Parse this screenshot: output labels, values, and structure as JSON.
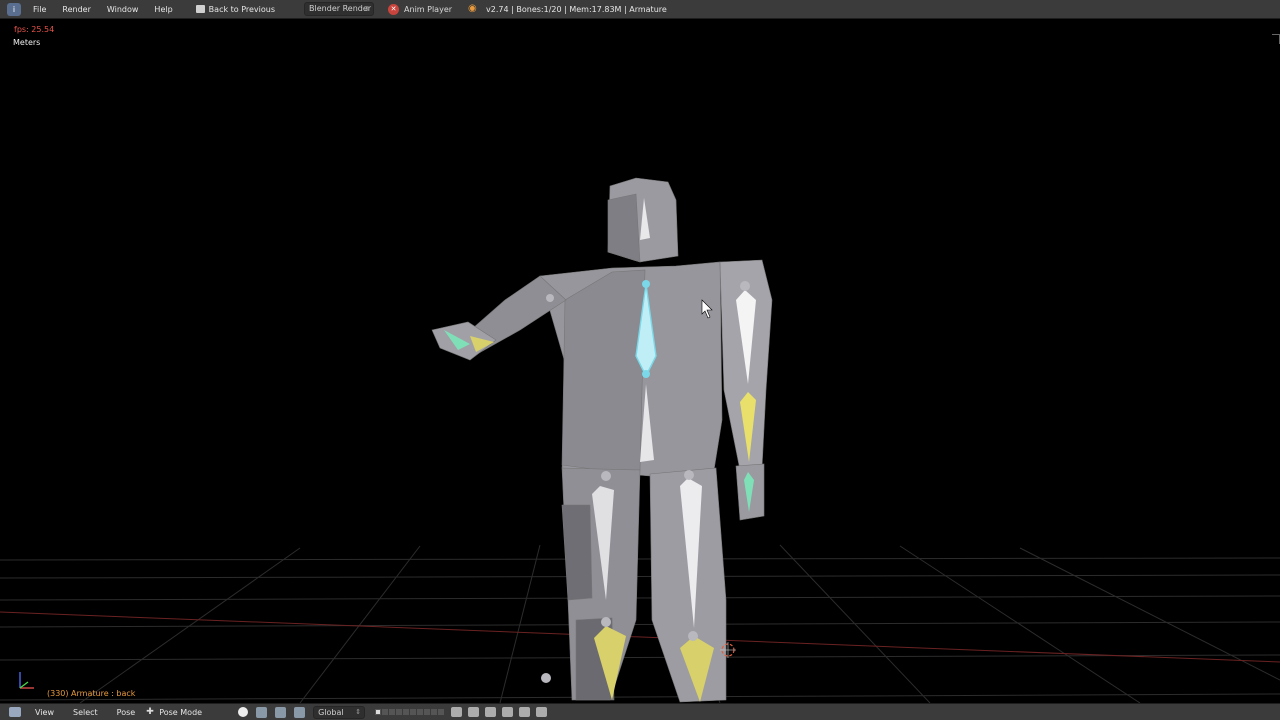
{
  "top_header": {
    "info_icon": "info-icon",
    "menu": [
      "File",
      "Render",
      "Window",
      "Help"
    ],
    "back_button": "Back to Previous",
    "render_engine": "Blender Render",
    "scene_name": "Anim Player",
    "stats": "v2.74 | Bones:1/20 | Mem:17.83M | Armature"
  },
  "viewport": {
    "fps": "fps: 25.54",
    "units": "Meters",
    "object_info": "(330) Armature : back"
  },
  "bottom_header": {
    "menu": [
      "View",
      "Select",
      "Pose"
    ],
    "mode": "Pose Mode",
    "orientation": "Global"
  },
  "colors": {
    "background": "#000000",
    "header": "#3b3b3b",
    "mesh": "#8f8f95",
    "bone_selected": "#7ad8e8",
    "bone_constrained": "#d8d06a",
    "bone_ik": "#6fd0a8",
    "grid": "#3a3a3a",
    "x_axis": "#7a2a2a",
    "fps_text": "#e8534a",
    "info_text": "#e89a3c"
  }
}
